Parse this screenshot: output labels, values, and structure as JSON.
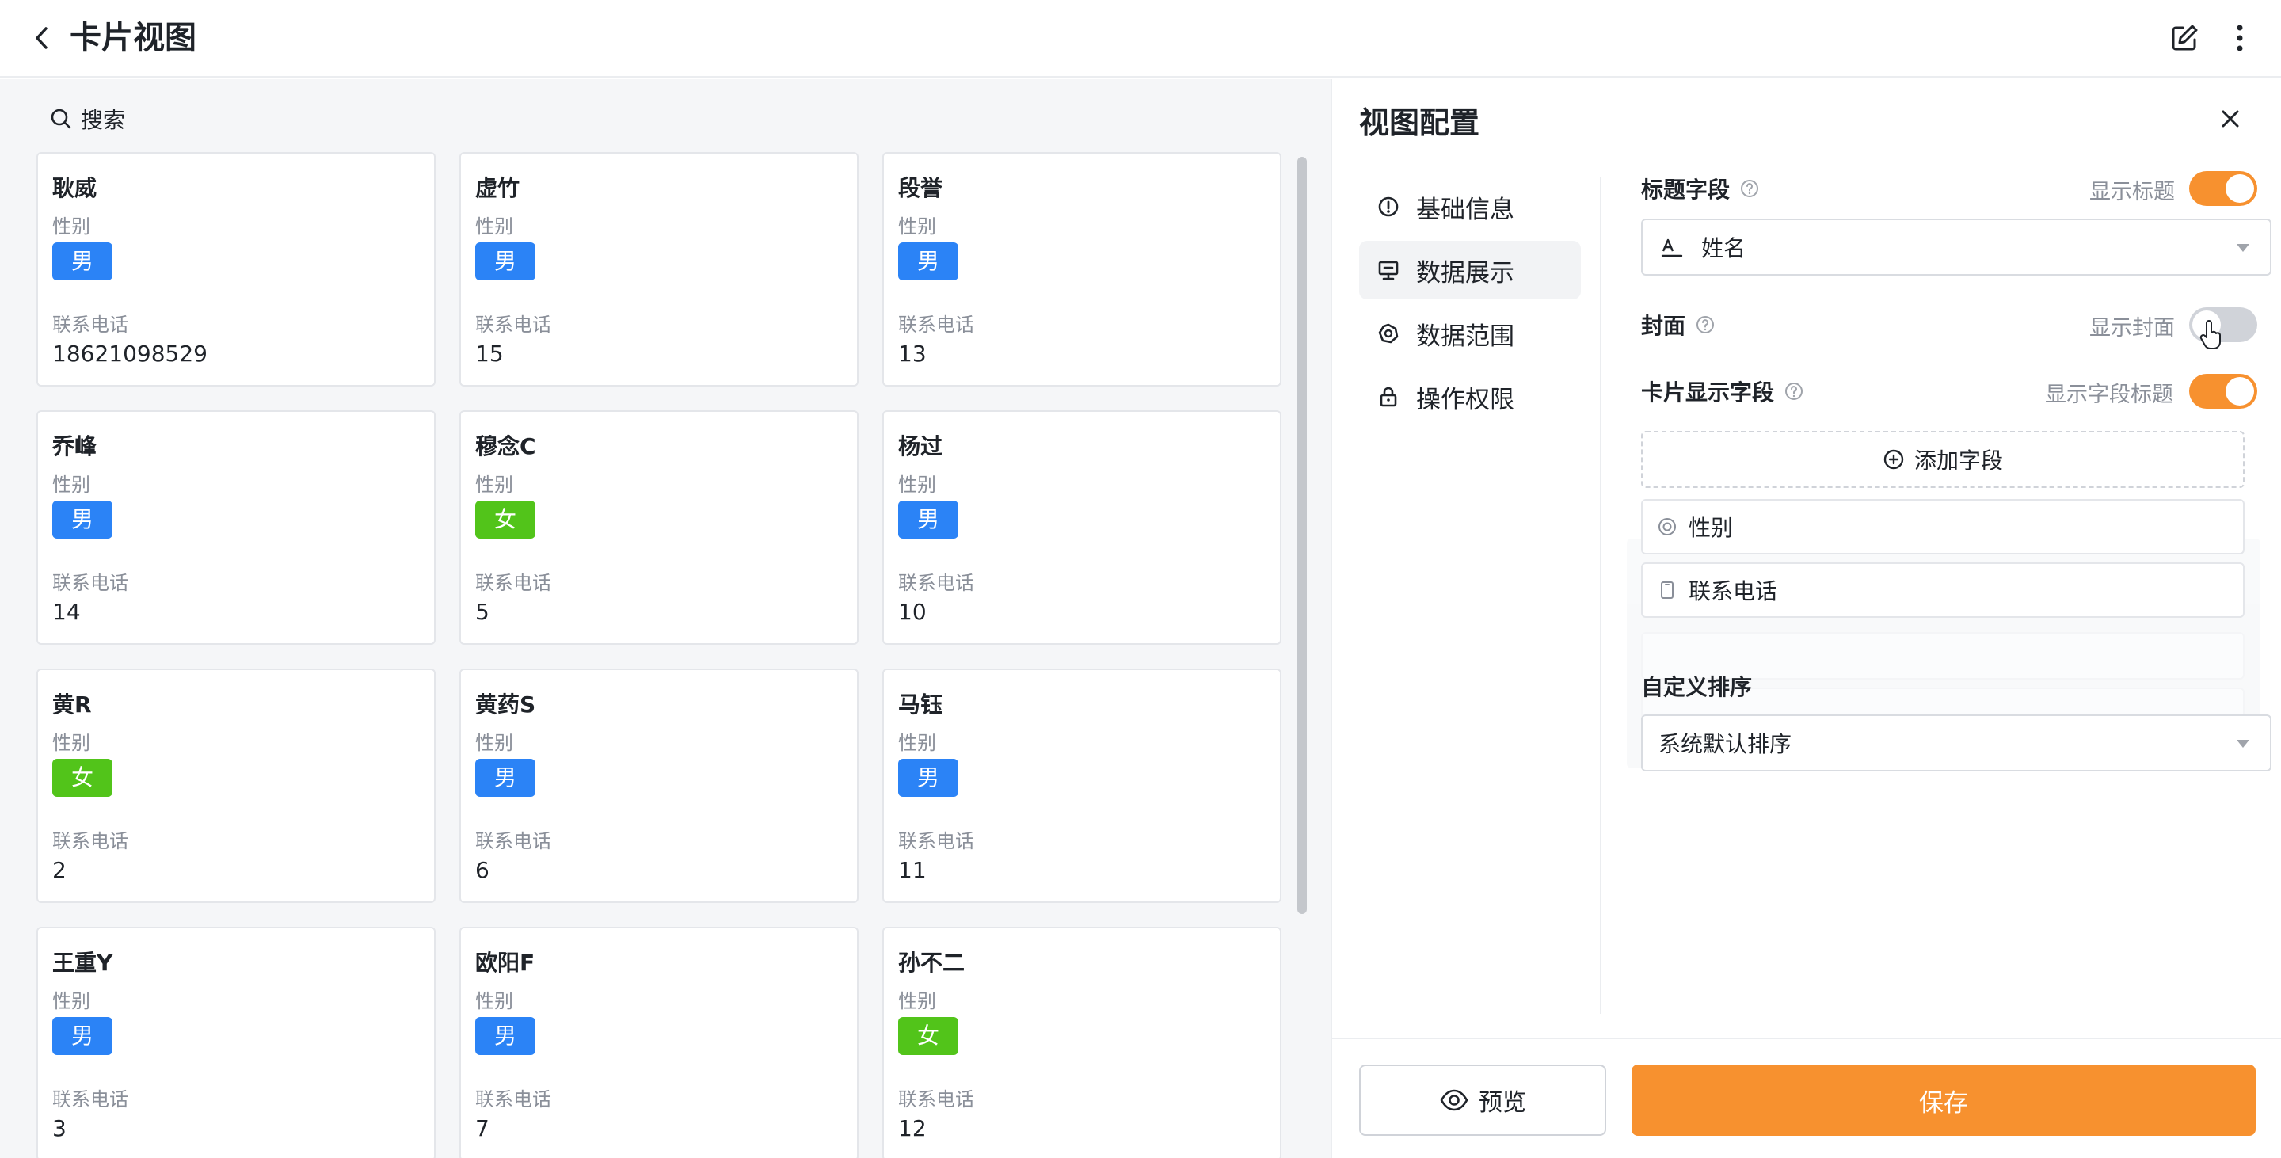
{
  "header": {
    "title": "卡片视图"
  },
  "search": {
    "placeholder": "搜索"
  },
  "card_labels": {
    "gender": "性别",
    "phone": "联系电话"
  },
  "cards": [
    {
      "name": "耿威",
      "gender": "男",
      "phone": "18621098529"
    },
    {
      "name": "虚竹",
      "gender": "男",
      "phone": "15"
    },
    {
      "name": "段誉",
      "gender": "男",
      "phone": "13"
    },
    {
      "name": "乔峰",
      "gender": "男",
      "phone": "14"
    },
    {
      "name": "穆念C",
      "gender": "女",
      "phone": "5"
    },
    {
      "name": "杨过",
      "gender": "男",
      "phone": "10"
    },
    {
      "name": "黄R",
      "gender": "女",
      "phone": "2"
    },
    {
      "name": "黄药S",
      "gender": "男",
      "phone": "6"
    },
    {
      "name": "马钰",
      "gender": "男",
      "phone": "11"
    },
    {
      "name": "王重Y",
      "gender": "男",
      "phone": "3"
    },
    {
      "name": "欧阳F",
      "gender": "男",
      "phone": "7"
    },
    {
      "name": "孙不二",
      "gender": "女",
      "phone": "12"
    }
  ],
  "panel": {
    "title": "视图配置",
    "nav": [
      {
        "label": "基础信息",
        "icon": "info-icon"
      },
      {
        "label": "数据展示",
        "icon": "display-icon",
        "active": true
      },
      {
        "label": "数据范围",
        "icon": "scope-icon"
      },
      {
        "label": "操作权限",
        "icon": "lock-icon"
      }
    ],
    "title_field": {
      "label": "标题字段",
      "toggle_label": "显示标题",
      "toggle_on": true,
      "value": "姓名"
    },
    "cover": {
      "label": "封面",
      "toggle_label": "显示封面",
      "toggle_on": false
    },
    "card_fields": {
      "label": "卡片显示字段",
      "toggle_label": "显示字段标题",
      "toggle_on": true,
      "add_label": "添加字段",
      "items": [
        {
          "label": "性别",
          "icon": "radio-icon"
        },
        {
          "label": "联系电话",
          "icon": "phone-icon"
        }
      ]
    },
    "sort": {
      "label": "自定义排序",
      "value": "系统默认排序"
    },
    "footer": {
      "preview_label": "预览",
      "save_label": "保存"
    }
  },
  "colors": {
    "accent": "#f7912f",
    "male_tag": "#2b83f6",
    "female_tag": "#52c41a"
  }
}
